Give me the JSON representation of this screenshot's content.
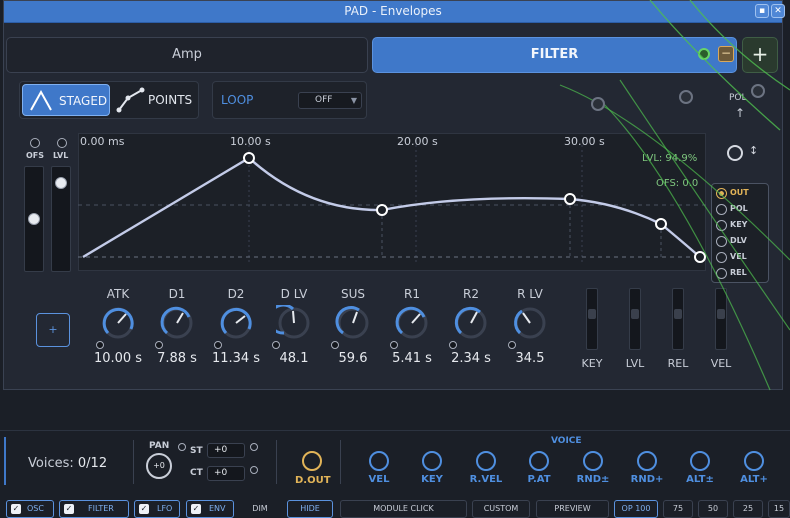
{
  "window": {
    "title": "PAD - Envelopes"
  },
  "tabs": [
    {
      "label": "Amp"
    },
    {
      "label": "FILTER"
    }
  ],
  "tab_add_label": "+",
  "tab_remove_label": "−",
  "modes": {
    "staged_label": "STAGED",
    "points_label": "POINTS"
  },
  "loop": {
    "label": "LOOP",
    "value": "OFF"
  },
  "side": {
    "ofs_label": "OFS",
    "lvl_label": "LVL"
  },
  "envelope": {
    "times": [
      "0.00 ms",
      "10.00 s",
      "20.00 s",
      "30.00 s"
    ],
    "lvl_readout": "LVL: 94.9%",
    "ofs_readout": "OFS: 0.0"
  },
  "targets": [
    "OUT",
    "POL",
    "KEY",
    "DLV",
    "VEL",
    "REL"
  ],
  "pol_label": "POL",
  "add_stage_label": "+",
  "knobs": [
    {
      "label": "ATK",
      "value": "10.00 s"
    },
    {
      "label": "D1",
      "value": "7.88 s"
    },
    {
      "label": "D2",
      "value": "11.34 s"
    },
    {
      "label": "D LV",
      "value": "48.1"
    },
    {
      "label": "SUS",
      "value": "59.6"
    },
    {
      "label": "R1",
      "value": "5.41 s"
    },
    {
      "label": "R2",
      "value": "2.34 s"
    },
    {
      "label": "R LV",
      "value": "34.5"
    }
  ],
  "mini_sliders": [
    "KEY",
    "LVL",
    "REL",
    "VEL"
  ],
  "lower": {
    "voices_label": "Voices:",
    "voices_value": "0/12",
    "pan_label": "PAN",
    "pan_value": "+0",
    "st_label": "ST",
    "st_value": "+0",
    "ct_label": "CT",
    "ct_value": "+0",
    "dout_label": "D.OUT",
    "voice_title": "VOICE",
    "voice_knobs": [
      "VEL",
      "KEY",
      "R.VEL",
      "P.AT",
      "RND±",
      "RND+",
      "ALT±",
      "ALT+"
    ]
  },
  "toolbar": {
    "osc": "OSC",
    "filter": "FILTER",
    "lfo": "LFO",
    "env": "ENV",
    "dim": "DIM",
    "hide": "HIDE",
    "module_click": "MODULE CLICK",
    "custom": "CUSTOM",
    "preview": "PREVIEW",
    "op100": "OP 100",
    "z75": "75",
    "z50": "50",
    "z25": "25",
    "z15": "15"
  },
  "colors": {
    "accent": "#3f78c9",
    "gold": "#e2b458",
    "green": "#7fc77f"
  }
}
